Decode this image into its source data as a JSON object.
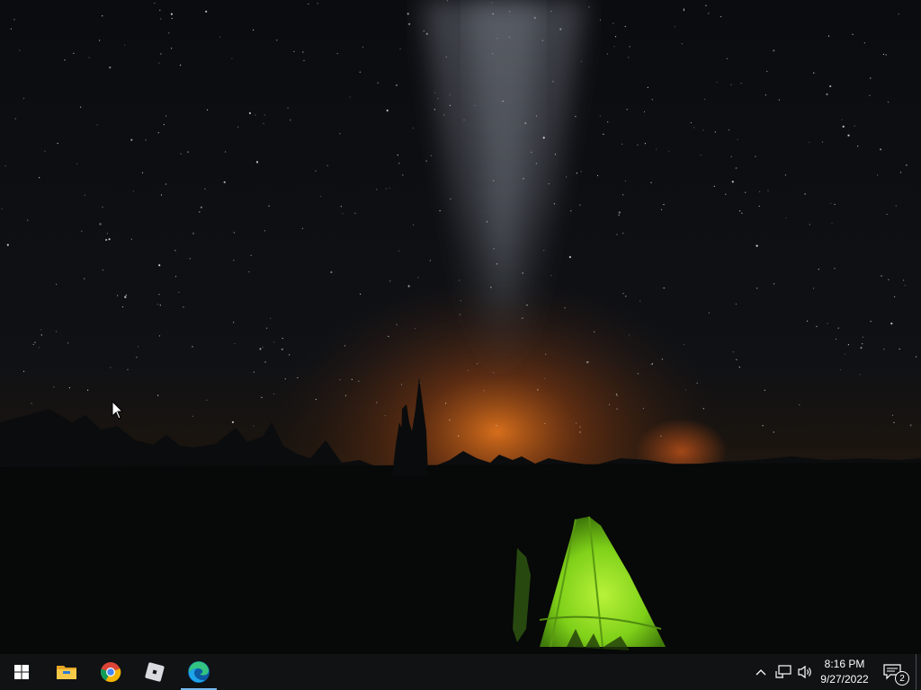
{
  "desktop": {
    "wallpaper": "starry-night-tent",
    "icons": []
  },
  "taskbar": {
    "start_icon": "windows-logo-icon",
    "accent_color": "#0078d4",
    "pinned": [
      {
        "name": "file-explorer",
        "icon": "folder-icon",
        "active": false
      },
      {
        "name": "google-chrome",
        "icon": "chrome-icon",
        "active": false
      },
      {
        "name": "roblox",
        "icon": "roblox-icon",
        "active": false
      },
      {
        "name": "microsoft-edge",
        "icon": "edge-icon",
        "active": true
      }
    ],
    "tray": {
      "icons": [
        "chevron-up-icon",
        "network-icon",
        "volume-icon"
      ],
      "time": "8:16 PM",
      "date": "9/27/2022",
      "notification_count": "2"
    }
  }
}
